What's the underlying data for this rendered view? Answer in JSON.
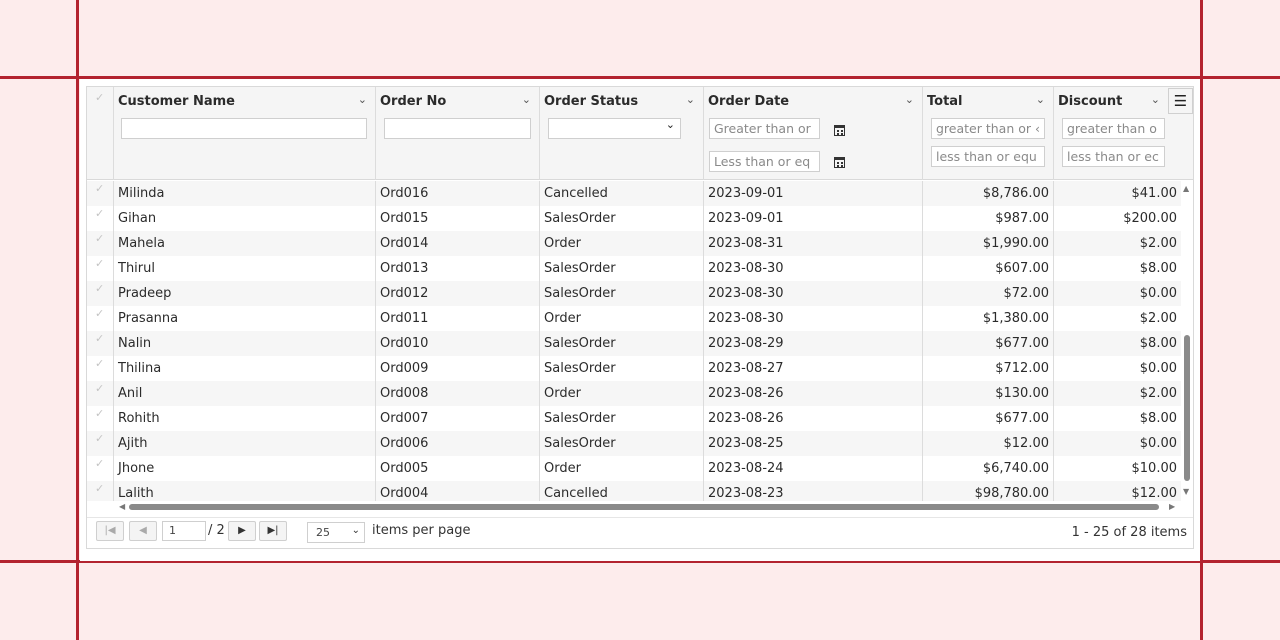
{
  "grid": {
    "columns": [
      {
        "key": "customer",
        "title": "Customer Name"
      },
      {
        "key": "order_no",
        "title": "Order No"
      },
      {
        "key": "status",
        "title": "Order Status"
      },
      {
        "key": "date",
        "title": "Order Date"
      },
      {
        "key": "total",
        "title": "Total"
      },
      {
        "key": "discount",
        "title": "Discount"
      }
    ],
    "filters": {
      "customer_value": "",
      "order_no_value": "",
      "status_selected": "",
      "date_from_placeholder": "Greater than or",
      "date_to_placeholder": "Less than or eq",
      "total_from_placeholder": "greater than or ‹",
      "total_to_placeholder": "less than or equ",
      "discount_from_placeholder": "greater than o",
      "discount_to_placeholder": "less than or ec"
    },
    "icons": {
      "chevron": "chevron-down-icon",
      "calendar": "calendar-icon",
      "check": "check-icon",
      "menu": "column-menu-icon"
    },
    "rows": [
      {
        "customer": "Milinda",
        "order_no": "Ord016",
        "status": "Cancelled",
        "date": "2023-09-01",
        "total": "$8,786.00",
        "discount": "$41.00"
      },
      {
        "customer": "Gihan",
        "order_no": "Ord015",
        "status": "SalesOrder",
        "date": "2023-09-01",
        "total": "$987.00",
        "discount": "$200.00"
      },
      {
        "customer": "Mahela",
        "order_no": "Ord014",
        "status": "Order",
        "date": "2023-08-31",
        "total": "$1,990.00",
        "discount": "$2.00"
      },
      {
        "customer": "Thirul",
        "order_no": "Ord013",
        "status": "SalesOrder",
        "date": "2023-08-30",
        "total": "$607.00",
        "discount": "$8.00"
      },
      {
        "customer": "Pradeep",
        "order_no": "Ord012",
        "status": "SalesOrder",
        "date": "2023-08-30",
        "total": "$72.00",
        "discount": "$0.00"
      },
      {
        "customer": "Prasanna",
        "order_no": "Ord011",
        "status": "Order",
        "date": "2023-08-30",
        "total": "$1,380.00",
        "discount": "$2.00"
      },
      {
        "customer": "Nalin",
        "order_no": "Ord010",
        "status": "SalesOrder",
        "date": "2023-08-29",
        "total": "$677.00",
        "discount": "$8.00"
      },
      {
        "customer": "Thilina",
        "order_no": "Ord009",
        "status": "SalesOrder",
        "date": "2023-08-27",
        "total": "$712.00",
        "discount": "$0.00"
      },
      {
        "customer": "Anil",
        "order_no": "Ord008",
        "status": "Order",
        "date": "2023-08-26",
        "total": "$130.00",
        "discount": "$2.00"
      },
      {
        "customer": "Rohith",
        "order_no": "Ord007",
        "status": "SalesOrder",
        "date": "2023-08-26",
        "total": "$677.00",
        "discount": "$8.00"
      },
      {
        "customer": "Ajith",
        "order_no": "Ord006",
        "status": "SalesOrder",
        "date": "2023-08-25",
        "total": "$12.00",
        "discount": "$0.00"
      },
      {
        "customer": "Jhone",
        "order_no": "Ord005",
        "status": "Order",
        "date": "2023-08-24",
        "total": "$6,740.00",
        "discount": "$10.00"
      },
      {
        "customer": "Lalith",
        "order_no": "Ord004",
        "status": "Cancelled",
        "date": "2023-08-23",
        "total": "$98,780.00",
        "discount": "$12.00"
      }
    ]
  },
  "pager": {
    "current_page": "1",
    "total_pages": "/ 2",
    "page_size": "25",
    "items_per_page_label": "items per page",
    "summary": "1 - 25 of 28 items"
  },
  "colors": {
    "frame": "#b3232f",
    "background": "#fdecec",
    "header": "#f5f5f5",
    "alt_row": "#f6f6f6"
  }
}
